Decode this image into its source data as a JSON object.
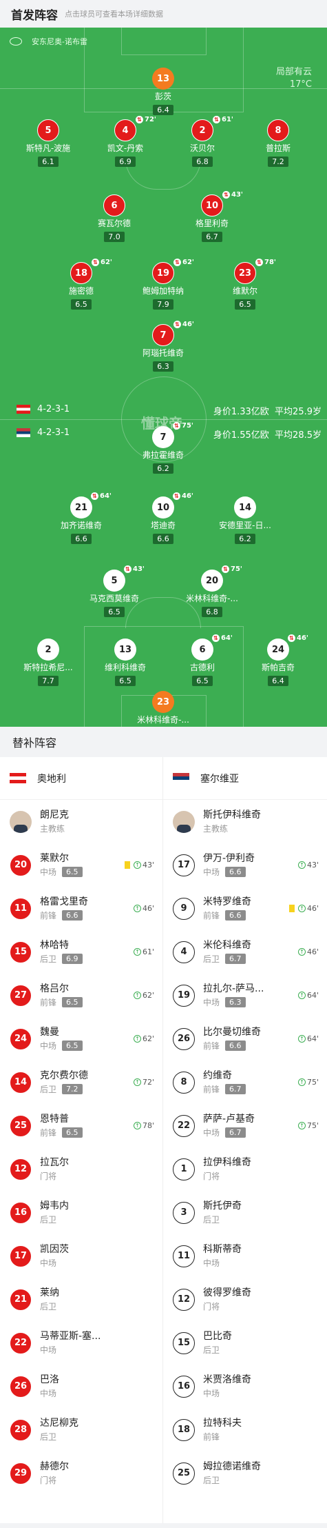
{
  "header": {
    "title": "首发阵容",
    "subtitle": "点击球员可查看本场详细数据"
  },
  "venue": "安东尼奥-诺布雷",
  "weather": {
    "condition": "局部有云",
    "temp": "17°C"
  },
  "watermark": "懂球帝",
  "austria": {
    "formation": "4-2-3-1",
    "value": "身价1.33亿欧",
    "age": "平均25.9岁"
  },
  "serbia": {
    "formation": "4-2-3-1",
    "value": "身价1.55亿欧",
    "age": "平均28.5岁"
  },
  "home_players": [
    {
      "num": "13",
      "name": "彭茨",
      "rating": "6.4",
      "color": "orange"
    },
    {
      "num": "5",
      "name": "斯特凡-波施",
      "rating": "6.1",
      "color": "red"
    },
    {
      "num": "4",
      "name": "凯文-丹索",
      "rating": "6.9",
      "color": "red",
      "sub": "72'"
    },
    {
      "num": "2",
      "name": "沃贝尔",
      "rating": "6.8",
      "color": "red",
      "sub": "61'"
    },
    {
      "num": "8",
      "name": "普拉斯",
      "rating": "7.2",
      "color": "red"
    },
    {
      "num": "6",
      "name": "赛瓦尔德",
      "rating": "7.0",
      "color": "red"
    },
    {
      "num": "10",
      "name": "格里利奇",
      "rating": "6.7",
      "color": "red",
      "sub": "43'"
    },
    {
      "num": "18",
      "name": "施密德",
      "rating": "6.5",
      "color": "red",
      "sub": "62'"
    },
    {
      "num": "19",
      "name": "鲍姆加特纳",
      "rating": "7.9",
      "color": "red",
      "sub": "62'"
    },
    {
      "num": "23",
      "name": "维默尔",
      "rating": "6.5",
      "color": "red",
      "sub": "78'"
    },
    {
      "num": "7",
      "name": "阿瑙托维奇",
      "rating": "6.3",
      "color": "red",
      "sub": "46'"
    }
  ],
  "away_players": [
    {
      "num": "7",
      "name": "弗拉霍维奇",
      "rating": "6.2",
      "sub": "75'"
    },
    {
      "num": "21",
      "name": "加齐诺维奇",
      "rating": "6.6",
      "sub": "64'"
    },
    {
      "num": "10",
      "name": "塔迪奇",
      "rating": "6.6",
      "sub": "46'"
    },
    {
      "num": "14",
      "name": "安德里亚-日...",
      "rating": "6.2"
    },
    {
      "num": "5",
      "name": "马克西莫维奇",
      "rating": "6.5",
      "sub": "43'"
    },
    {
      "num": "20",
      "name": "米林科维奇-...",
      "rating": "6.8",
      "sub": "75'"
    },
    {
      "num": "2",
      "name": "斯特拉希尼...",
      "rating": "7.7"
    },
    {
      "num": "13",
      "name": "维利科维奇",
      "rating": "6.5"
    },
    {
      "num": "6",
      "name": "古德利",
      "rating": "6.5",
      "sub": "64'"
    },
    {
      "num": "24",
      "name": "斯帕吉奇",
      "rating": "6.4",
      "sub": "46'"
    },
    {
      "num": "23",
      "name": "米林科维奇-...",
      "rating": "6.4"
    }
  ],
  "bench": {
    "title": "替补阵容",
    "home": {
      "team": "奥地利",
      "coach": {
        "name": "朗尼克",
        "role": "主教练"
      },
      "players": [
        {
          "num": "20",
          "name": "莱默尔",
          "pos": "中场",
          "rating": "6.5",
          "min": "43'",
          "yellow": true
        },
        {
          "num": "11",
          "name": "格雷戈里奇",
          "pos": "前锋",
          "rating": "6.6",
          "min": "46'"
        },
        {
          "num": "15",
          "name": "林哈特",
          "pos": "后卫",
          "rating": "6.9",
          "min": "61'"
        },
        {
          "num": "27",
          "name": "格吕尔",
          "pos": "前锋",
          "rating": "6.5",
          "min": "62'"
        },
        {
          "num": "24",
          "name": "魏曼",
          "pos": "中场",
          "rating": "6.5",
          "min": "62'"
        },
        {
          "num": "14",
          "name": "克尔费尔德",
          "pos": "后卫",
          "rating": "7.2",
          "min": "72'"
        },
        {
          "num": "25",
          "name": "恩特普",
          "pos": "前锋",
          "rating": "6.5",
          "min": "78'"
        },
        {
          "num": "12",
          "name": "拉瓦尔",
          "pos": "门将"
        },
        {
          "num": "16",
          "name": "姆韦内",
          "pos": "后卫"
        },
        {
          "num": "17",
          "name": "凯因茨",
          "pos": "中场"
        },
        {
          "num": "21",
          "name": "莱纳",
          "pos": "后卫"
        },
        {
          "num": "22",
          "name": "马蒂亚斯-塞...",
          "pos": "中场"
        },
        {
          "num": "26",
          "name": "巴洛",
          "pos": "中场"
        },
        {
          "num": "28",
          "name": "达尼柳克",
          "pos": "后卫"
        },
        {
          "num": "29",
          "name": "赫德尔",
          "pos": "门将"
        }
      ]
    },
    "away": {
      "team": "塞尔维亚",
      "coach": {
        "name": "斯托伊科维奇",
        "role": "主教练"
      },
      "players": [
        {
          "num": "17",
          "name": "伊万-伊利奇",
          "pos": "中场",
          "rating": "6.6",
          "min": "43'"
        },
        {
          "num": "9",
          "name": "米特罗维奇",
          "pos": "前锋",
          "rating": "6.6",
          "min": "46'",
          "yellow": true
        },
        {
          "num": "4",
          "name": "米伦科维奇",
          "pos": "后卫",
          "rating": "6.7",
          "min": "46'"
        },
        {
          "num": "19",
          "name": "拉扎尔-萨马...",
          "pos": "中场",
          "rating": "6.3",
          "min": "64'"
        },
        {
          "num": "26",
          "name": "比尔曼切维奇",
          "pos": "前锋",
          "rating": "6.6",
          "min": "64'"
        },
        {
          "num": "8",
          "name": "约维奇",
          "pos": "前锋",
          "rating": "6.7",
          "min": "75'"
        },
        {
          "num": "22",
          "name": "萨萨-卢基奇",
          "pos": "中场",
          "rating": "6.7",
          "min": "75'"
        },
        {
          "num": "1",
          "name": "拉伊科维奇",
          "pos": "门将"
        },
        {
          "num": "3",
          "name": "斯托伊奇",
          "pos": "后卫"
        },
        {
          "num": "11",
          "name": "科斯蒂奇",
          "pos": "中场"
        },
        {
          "num": "12",
          "name": "彼得罗维奇",
          "pos": "门将"
        },
        {
          "num": "15",
          "name": "巴比奇",
          "pos": "后卫"
        },
        {
          "num": "16",
          "name": "米贾洛维奇",
          "pos": "中场"
        },
        {
          "num": "18",
          "name": "拉特科夫",
          "pos": "前锋"
        },
        {
          "num": "25",
          "name": "姆拉德诺维奇",
          "pos": "后卫"
        }
      ]
    }
  }
}
